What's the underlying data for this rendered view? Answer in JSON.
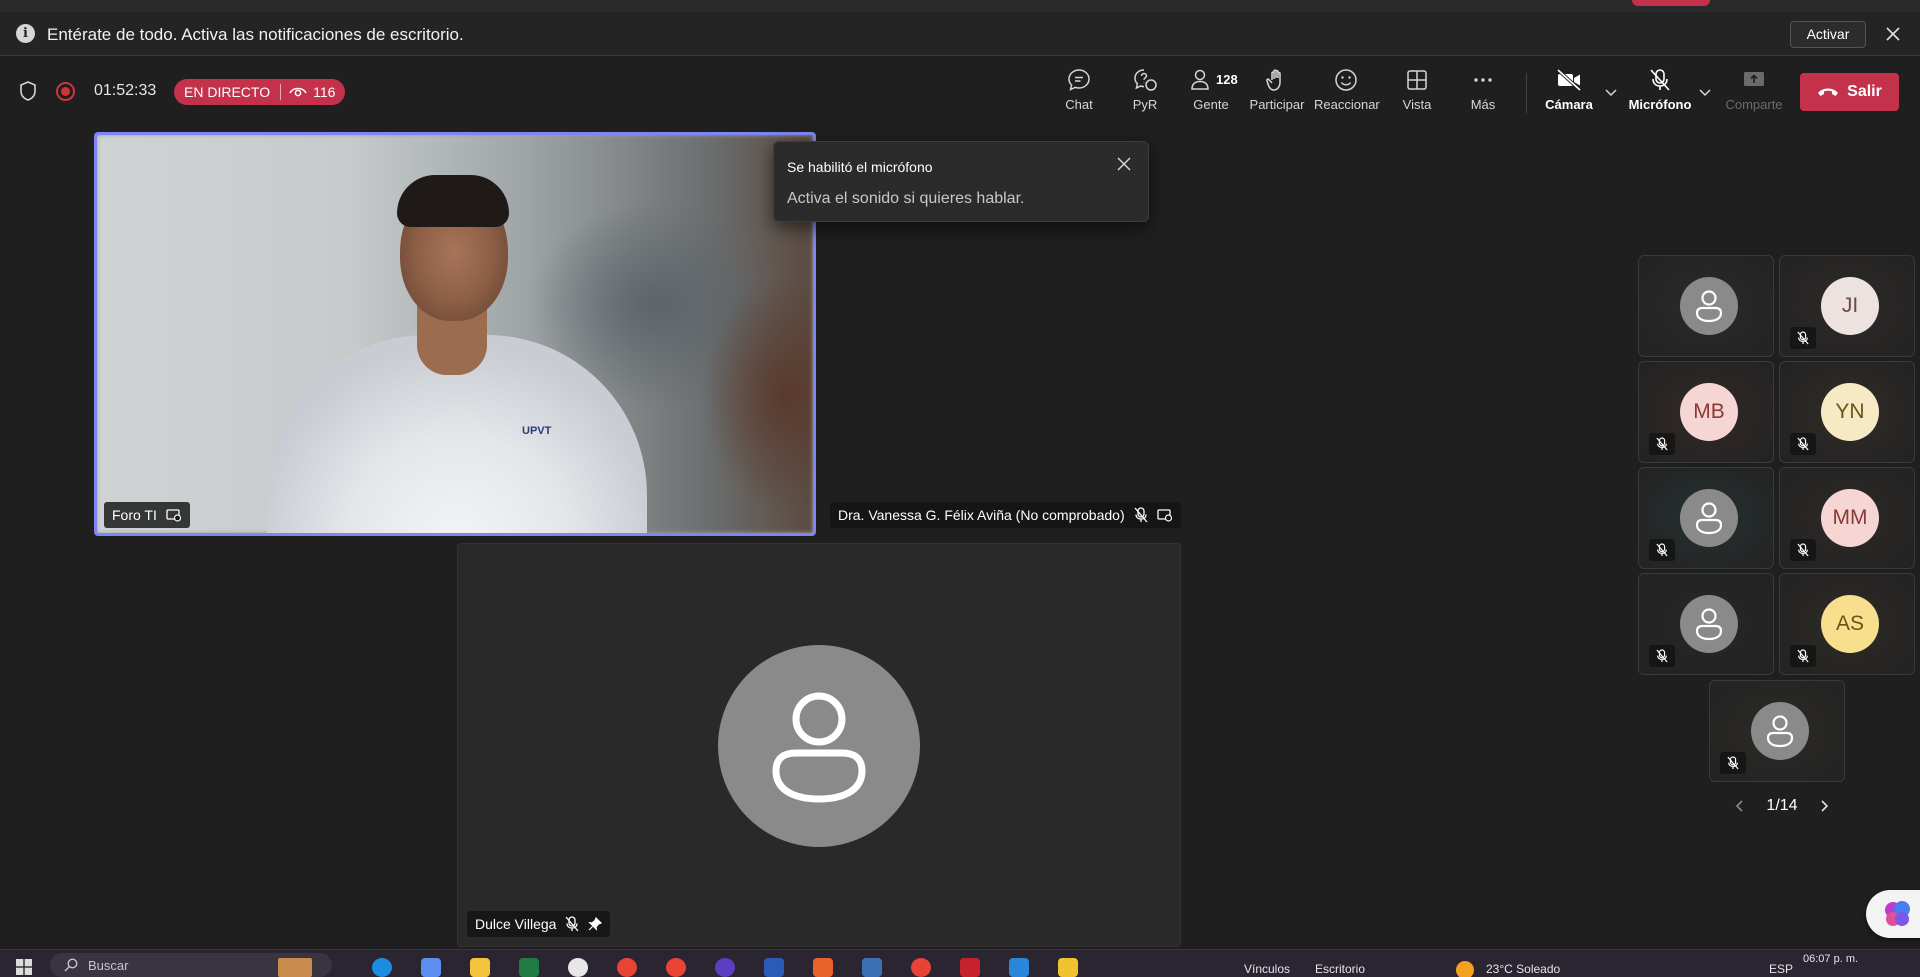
{
  "notification": {
    "message": "Entérate de todo. Activa las notificaciones de escritorio.",
    "activate_label": "Activar"
  },
  "meeting": {
    "timer": "01:52:33",
    "live_label": "EN DIRECTO",
    "viewers": "116"
  },
  "toolbar": {
    "chat": "Chat",
    "qa": "PyR",
    "people": "Gente",
    "people_count": "128",
    "raise": "Participar",
    "react": "Reaccionar",
    "view": "Vista",
    "more": "Más",
    "camera": "Cámara",
    "mic": "Micrófono",
    "share": "Comparte",
    "leave": "Salir"
  },
  "toast": {
    "title": "Se habilitó el micrófono",
    "body": "Activa el sonido si quieres hablar."
  },
  "stage": {
    "speaker_name": "Foro TI",
    "speaker_shirt_logo": "UPVT",
    "second_name": "Dra. Vanessa G. Félix Aviña (No comprobado)",
    "main_tile_name": "Dulce Villega"
  },
  "gallery": {
    "tiles": [
      {
        "initials": "",
        "avatar_color": "#8a8a8a",
        "muted": false
      },
      {
        "initials": "JI",
        "avatar_color": "#ece2e0",
        "text_color": "#6b4b45",
        "muted": true
      },
      {
        "initials": "MB",
        "avatar_color": "#f6d6d4",
        "text_color": "#8a3b36",
        "muted": true
      },
      {
        "initials": "YN",
        "avatar_color": "#f6e9c4",
        "text_color": "#6b5318",
        "muted": true
      },
      {
        "initials": "",
        "avatar_color": "#8a8a8a",
        "muted": true
      },
      {
        "initials": "MM",
        "avatar_color": "#f6d6d4",
        "text_color": "#8a3b36",
        "muted": true
      },
      {
        "initials": "",
        "avatar_color": "#8a8a8a",
        "muted": true
      },
      {
        "initials": "AS",
        "avatar_color": "#f7df8e",
        "text_color": "#6b5318",
        "muted": true
      },
      {
        "initials": "",
        "avatar_color": "#8a8a8a",
        "muted": true
      }
    ],
    "page": "1/14"
  },
  "taskbar": {
    "search_placeholder": "Buscar",
    "links_label": "Vínculos",
    "desktop_label": "Escritorio",
    "weather": "23°C  Soleado",
    "language": "ESP",
    "time": "06:07 p. m."
  },
  "colors": {
    "accent": "#7f85f5",
    "live": "#c4314b",
    "leave": "#c4314b"
  }
}
